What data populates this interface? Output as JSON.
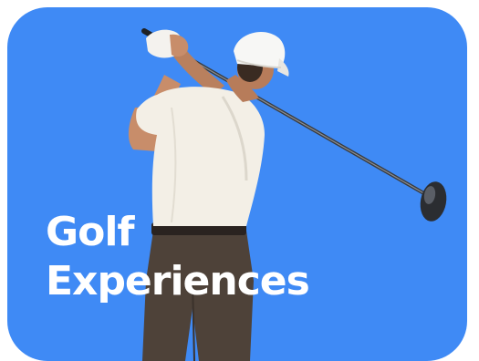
{
  "card": {
    "title_line1": "Golf",
    "title_line2": "Experiences",
    "background_color": "#3f8af5",
    "image": "golfer-swinging-driver"
  }
}
